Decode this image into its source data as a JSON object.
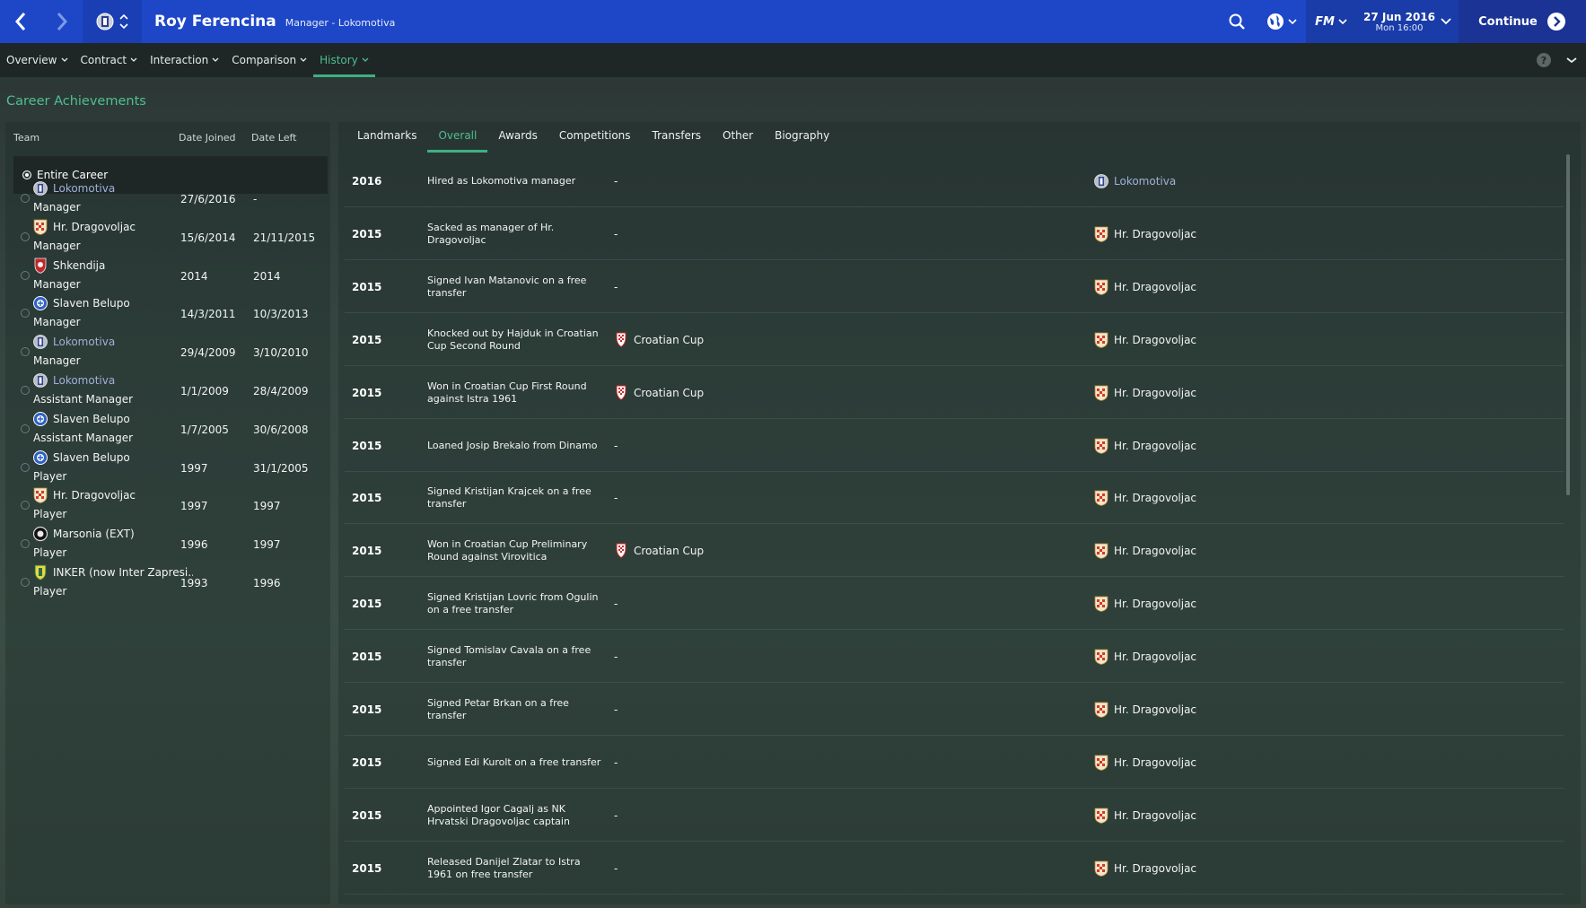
{
  "header": {
    "name": "Roy Ferencina",
    "subtitle": "Manager - Lokomotiva",
    "date": "27 Jun 2016",
    "time": "Mon 16:00",
    "continue_label": "Continue",
    "fm_label": "FM"
  },
  "subnav": [
    {
      "label": "Overview",
      "active": false
    },
    {
      "label": "Contract",
      "active": false
    },
    {
      "label": "Interaction",
      "active": false
    },
    {
      "label": "Comparison",
      "active": false
    },
    {
      "label": "History",
      "active": true
    }
  ],
  "career": {
    "title": "Career Achievements",
    "headers": {
      "team": "Team",
      "joined": "Date Joined",
      "left": "Date Left"
    },
    "entire_label": "Entire Career",
    "rows": [
      {
        "team": "Lokomotiva",
        "crest": "lokomotiva-crest",
        "link": true,
        "role": "Manager",
        "joined": "27/6/2016",
        "left": "-"
      },
      {
        "team": "Hr. Dragovoljac",
        "crest": "dragovoljac-crest",
        "link": false,
        "role": "Manager",
        "joined": "15/6/2014",
        "left": "21/11/2015"
      },
      {
        "team": "Shkendija",
        "crest": "shkendija-crest",
        "link": false,
        "role": "Manager",
        "joined": "2014",
        "left": "2014"
      },
      {
        "team": "Slaven Belupo",
        "crest": "belupo-crest",
        "link": false,
        "role": "Manager",
        "joined": "14/3/2011",
        "left": "10/3/2013"
      },
      {
        "team": "Lokomotiva",
        "crest": "lokomotiva-crest",
        "link": true,
        "role": "Manager",
        "joined": "29/4/2009",
        "left": "3/10/2010"
      },
      {
        "team": "Lokomotiva",
        "crest": "lokomotiva-crest",
        "link": true,
        "role": "Assistant Manager",
        "joined": "1/1/2009",
        "left": "28/4/2009"
      },
      {
        "team": "Slaven Belupo",
        "crest": "belupo-crest",
        "link": false,
        "role": "Assistant Manager",
        "joined": "1/7/2005",
        "left": "30/6/2008"
      },
      {
        "team": "Slaven Belupo",
        "crest": "belupo-crest",
        "link": false,
        "role": "Player",
        "joined": "1997",
        "left": "31/1/2005"
      },
      {
        "team": "Hr. Dragovoljac",
        "crest": "dragovoljac-crest",
        "link": false,
        "role": "Player",
        "joined": "1997",
        "left": "1997"
      },
      {
        "team": "Marsonia (EXT)",
        "crest": "marsonia-crest",
        "link": false,
        "role": "Player",
        "joined": "1996",
        "left": "1997"
      },
      {
        "team": "INKER (now Inter Zapresi...",
        "crest": "inker-crest",
        "link": false,
        "role": "Player",
        "joined": "1993",
        "left": "1996"
      }
    ]
  },
  "tabs": [
    {
      "label": "Landmarks",
      "active": false
    },
    {
      "label": "Overall",
      "active": true
    },
    {
      "label": "Awards",
      "active": false
    },
    {
      "label": "Competitions",
      "active": false
    },
    {
      "label": "Transfers",
      "active": false
    },
    {
      "label": "Other",
      "active": false
    },
    {
      "label": "Biography",
      "active": false
    }
  ],
  "timeline": [
    {
      "year": "2016",
      "event": "Hired as Lokomotiva manager",
      "competition": "-",
      "club": "Lokomotiva",
      "club_link": true
    },
    {
      "year": "2015",
      "event": "Sacked as manager of Hr. Dragovoljac",
      "competition": "-",
      "club": "Hr. Dragovoljac",
      "club_link": false
    },
    {
      "year": "2015",
      "event": "Signed Ivan Matanovic on a free transfer",
      "competition": "-",
      "club": "Hr. Dragovoljac",
      "club_link": false
    },
    {
      "year": "2015",
      "event": "Knocked out by Hajduk in Croatian Cup Second Round",
      "competition": "Croatian Cup",
      "club": "Hr. Dragovoljac",
      "club_link": false
    },
    {
      "year": "2015",
      "event": "Won in Croatian Cup First Round against Istra 1961",
      "competition": "Croatian Cup",
      "club": "Hr. Dragovoljac",
      "club_link": false
    },
    {
      "year": "2015",
      "event": "Loaned Josip Brekalo from Dinamo",
      "competition": "-",
      "club": "Hr. Dragovoljac",
      "club_link": false
    },
    {
      "year": "2015",
      "event": "Signed Kristijan Krajcek on a free transfer",
      "competition": "-",
      "club": "Hr. Dragovoljac",
      "club_link": false
    },
    {
      "year": "2015",
      "event": "Won in Croatian Cup Preliminary Round against Virovitica",
      "competition": "Croatian Cup",
      "club": "Hr. Dragovoljac",
      "club_link": false
    },
    {
      "year": "2015",
      "event": "Signed Kristijan Lovric from Ogulin on a free transfer",
      "competition": "-",
      "club": "Hr. Dragovoljac",
      "club_link": false
    },
    {
      "year": "2015",
      "event": "Signed Tomislav Cavala on a free transfer",
      "competition": "-",
      "club": "Hr. Dragovoljac",
      "club_link": false
    },
    {
      "year": "2015",
      "event": "Signed Petar Brkan on a free transfer",
      "competition": "-",
      "club": "Hr. Dragovoljac",
      "club_link": false
    },
    {
      "year": "2015",
      "event": "Signed Edi Kurolt on a free transfer",
      "competition": "-",
      "club": "Hr. Dragovoljac",
      "club_link": false
    },
    {
      "year": "2015",
      "event": "Appointed Igor Cagalj as NK Hrvatski Dragovoljac captain",
      "competition": "-",
      "club": "Hr. Dragovoljac",
      "club_link": false
    },
    {
      "year": "2015",
      "event": "Released Danijel Zlatar to Istra 1961 on free transfer",
      "competition": "-",
      "club": "Hr. Dragovoljac",
      "club_link": false
    }
  ],
  "colors": {
    "topbar": "#1e47c8",
    "accent_green": "#4fbf92",
    "link_blue": "#9fb0d8"
  }
}
